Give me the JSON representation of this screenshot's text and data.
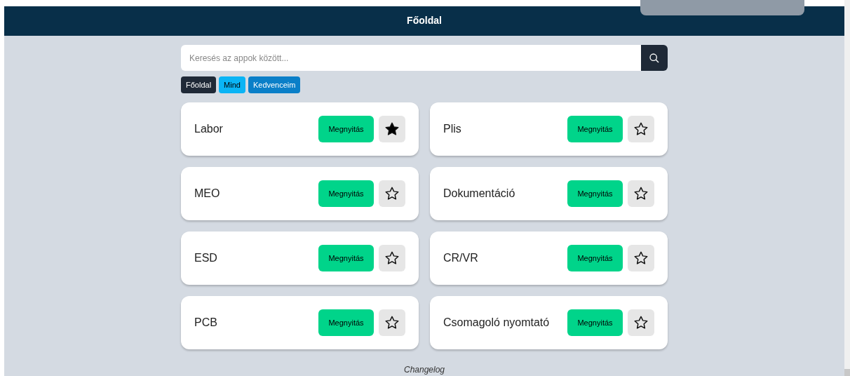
{
  "header": {
    "title": "Főoldal"
  },
  "search": {
    "placeholder": "Keresés az appok között..."
  },
  "filters": [
    {
      "label": "Főoldal",
      "kind": "home"
    },
    {
      "label": "Mind",
      "kind": "all"
    },
    {
      "label": "Kedvenceim",
      "kind": "favorites"
    }
  ],
  "apps": [
    {
      "name": "Labor",
      "button": "Megnyitás",
      "favorite": true
    },
    {
      "name": "Plis",
      "button": "Megnyitás",
      "favorite": false
    },
    {
      "name": "MEO",
      "button": "Megnyitás",
      "favorite": false
    },
    {
      "name": "Dokumentáció",
      "button": "Megnyitás",
      "favorite": false
    },
    {
      "name": "ESD",
      "button": "Megnyitás",
      "favorite": false
    },
    {
      "name": "CR/VR",
      "button": "Megnyitás",
      "favorite": false
    },
    {
      "name": "PCB",
      "button": "Megnyitás",
      "favorite": false
    },
    {
      "name": "Csomagoló nyomtató",
      "button": "Megnyitás",
      "favorite": false
    }
  ],
  "footer": {
    "link": "Changelog"
  }
}
